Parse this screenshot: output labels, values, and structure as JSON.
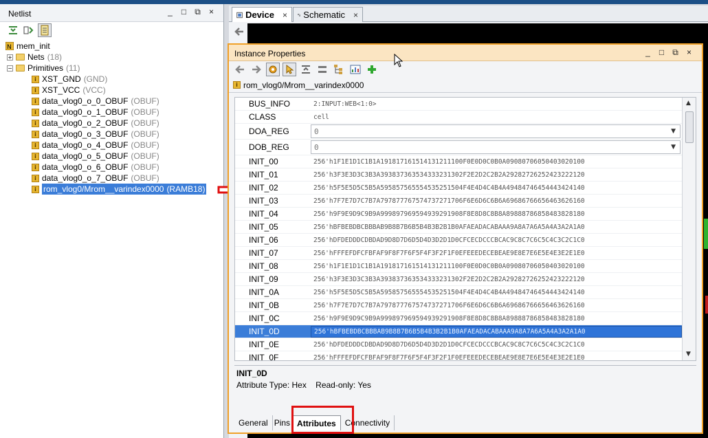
{
  "netlist": {
    "title": "Netlist",
    "window_buttons": [
      "_",
      "□",
      "⧉",
      "×"
    ],
    "tree": {
      "root": "mem_init",
      "nets": {
        "label": "Nets",
        "count": "(18)"
      },
      "primitives": {
        "label": "Primitives",
        "count": "(11)"
      },
      "items": [
        {
          "label": "XST_GND",
          "type": "(GND)"
        },
        {
          "label": "XST_VCC",
          "type": "(VCC)"
        },
        {
          "label": "data_vlog0_o_0_OBUF",
          "type": "(OBUF)"
        },
        {
          "label": "data_vlog0_o_1_OBUF",
          "type": "(OBUF)"
        },
        {
          "label": "data_vlog0_o_2_OBUF",
          "type": "(OBUF)"
        },
        {
          "label": "data_vlog0_o_3_OBUF",
          "type": "(OBUF)"
        },
        {
          "label": "data_vlog0_o_4_OBUF",
          "type": "(OBUF)"
        },
        {
          "label": "data_vlog0_o_5_OBUF",
          "type": "(OBUF)"
        },
        {
          "label": "data_vlog0_o_6_OBUF",
          "type": "(OBUF)"
        },
        {
          "label": "data_vlog0_o_7_OBUF",
          "type": "(OBUF)"
        },
        {
          "label": "rom_vlog0/Mrom__varindex0000",
          "type": "(RAMB18)"
        }
      ]
    }
  },
  "doc_tabs": [
    {
      "label": "Device",
      "close": "×"
    },
    {
      "label": "Schematic",
      "close": "×"
    }
  ],
  "instance_properties": {
    "title": "Instance Properties",
    "window_buttons": [
      "_",
      "□",
      "⧉",
      "×"
    ],
    "path": "rom_vlog0/Mrom__varindex0000",
    "properties": [
      {
        "key": "BUS_INFO",
        "value": "2:INPUT:WEB<1:0>"
      },
      {
        "key": "CLASS",
        "value": "cell"
      },
      {
        "key": "DOA_REG",
        "value": "0"
      },
      {
        "key": "DOB_REG",
        "value": "0"
      },
      {
        "key": "INIT_00",
        "value": "256'h1F1E1D1C1B1A191817161514131211100F0E0D0C0B0A09080706050403020100"
      },
      {
        "key": "INIT_01",
        "value": "256'h3F3E3D3C3B3A393837363534333231302F2E2D2C2B2A29282726252423222120"
      },
      {
        "key": "INIT_02",
        "value": "256'h5F5E5D5C5B5A595857565554535251504F4E4D4C4B4A49484746454443424140"
      },
      {
        "key": "INIT_03",
        "value": "256'h7F7E7D7C7B7A797877767574737271706F6E6D6C6B6A69686766656463626160"
      },
      {
        "key": "INIT_04",
        "value": "256'h9F9E9D9C9B9A999897969594939291908F8E8D8C8B8A89888786858483828180"
      },
      {
        "key": "INIT_05",
        "value": "256'hBFBEBDBCBBBAB9B8B7B6B5B4B3B2B1B0AFAEADACABAAA9A8A7A6A5A4A3A2A1A0"
      },
      {
        "key": "INIT_06",
        "value": "256'hDFDEDDDCDBDAD9D8D7D6D5D4D3D2D1D0CFCECDCCCBCAC9C8C7C6C5C4C3C2C1C0"
      },
      {
        "key": "INIT_07",
        "value": "256'hFFFEFDFCFBFAF9F8F7F6F5F4F3F2F1F0EFEEEDECEBEAE9E8E7E6E5E4E3E2E1E0"
      },
      {
        "key": "INIT_08",
        "value": "256'h1F1E1D1C1B1A191817161514131211100F0E0D0C0B0A09080706050403020100"
      },
      {
        "key": "INIT_09",
        "value": "256'h3F3E3D3C3B3A393837363534333231302F2E2D2C2B2A29282726252423222120"
      },
      {
        "key": "INIT_0A",
        "value": "256'h5F5E5D5C5B5A595857565554535251504F4E4D4C4B4A49484746454443424140"
      },
      {
        "key": "INIT_0B",
        "value": "256'h7F7E7D7C7B7A797877767574737271706F6E6D6C6B6A69686766656463626160"
      },
      {
        "key": "INIT_0C",
        "value": "256'h9F9E9D9C9B9A999897969594939291908F8E8D8C8B8A89888786858483828180"
      },
      {
        "key": "INIT_0D",
        "value": "256'hBFBEBDBCBBBAB9B8B7B6B5B4B3B2B1B0AFAEADACABAAA9A8A7A6A5A4A3A2A1A0"
      },
      {
        "key": "INIT_0E",
        "value": "256'hDFDEDDDCDBDAD9D8D7D6D5D4D3D2D1D0CFCECDCCCBCAC9C8C7C6C5C4C3C2C1C0"
      },
      {
        "key": "INIT_0F",
        "value": "256'hFFFEFDFCFBFAF9F8F7F6F5F4F3F2F1F0EFEEEDECEBEAE9E8E7E6E5E4E3E2E1E0"
      }
    ],
    "selected_key": "INIT_0D",
    "description": {
      "title": "INIT_0D",
      "line": "Attribute Type: Hex    Read-only: Yes"
    },
    "bottom_tabs": [
      {
        "label": "General"
      },
      {
        "label": "Pins"
      },
      {
        "label": "Attributes"
      },
      {
        "label": "Connectivity"
      }
    ],
    "active_tab": "Attributes"
  },
  "colors": {
    "selection": "#3b7dd8",
    "panel_border": "#f0a028",
    "highlight_red": "#e01010"
  }
}
